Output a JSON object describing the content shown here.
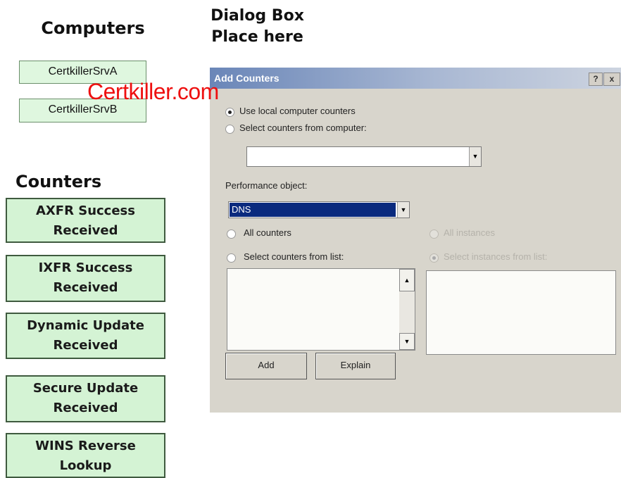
{
  "headings": {
    "computers": "Computers",
    "dialog_line1": "Dialog Box",
    "dialog_line2": "Place here",
    "counters": "Counters"
  },
  "computers": [
    "CertkillerSrvA",
    "CertkillerSrvB"
  ],
  "watermark": "Certkiller.com",
  "counters": [
    {
      "line1": "AXFR Success",
      "line2": "Received"
    },
    {
      "line1": "IXFR Success",
      "line2": "Received"
    },
    {
      "line1": "Dynamic Update",
      "line2": "Received"
    },
    {
      "line1": "Secure Update",
      "line2": "Received"
    },
    {
      "line1": "WINS Reverse",
      "line2": "Lookup"
    }
  ],
  "dialog": {
    "title": "Add Counters",
    "help_label": "?",
    "close_label": "x",
    "use_local_label": "Use local computer counters",
    "select_computer_label": "Select counters from computer:",
    "computer_value": "",
    "performance_object_label": "Performance object:",
    "performance_object_value": "DNS",
    "all_counters_label": "All counters",
    "select_counters_label": "Select counters from list:",
    "all_instances_label": "All instances",
    "select_instances_label": "Select instances from list:",
    "add_label": "Add",
    "explain_label": "Explain"
  },
  "icons": {
    "dropdown": "chevron-down-icon",
    "scroll_up": "arrow-up-icon",
    "scroll_down": "arrow-down-icon"
  },
  "colors": {
    "computer_box": "#dff7df",
    "counter_box": "#d4f3d4",
    "watermark": "#ee1010",
    "selection": "#0a2a7e"
  }
}
